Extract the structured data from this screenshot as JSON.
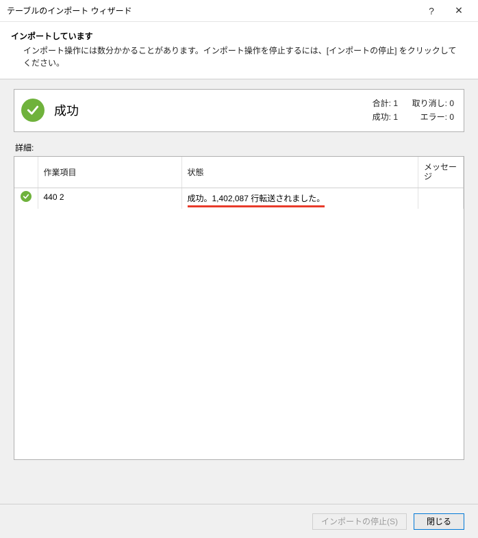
{
  "window": {
    "title": "テーブルのインポート ウィザード",
    "help_icon": "?",
    "close_icon": "✕"
  },
  "header": {
    "title": "インポートしています",
    "description": "インポート操作には数分かかることがあります。インポート操作を停止するには、[インポートの停止] をクリックしてください。"
  },
  "status": {
    "label": "成功",
    "counts": {
      "total_label": "合計:",
      "total_value": "1",
      "cancelled_label": "取り消し:",
      "cancelled_value": "0",
      "success_label": "成功:",
      "success_value": "1",
      "error_label": "エラー:",
      "error_value": "0"
    }
  },
  "details": {
    "label": "詳細:",
    "columns": {
      "icon": "",
      "task": "作業項目",
      "state": "状態",
      "message": "メッセージ"
    },
    "rows": [
      {
        "task": "440 2",
        "state": "成功。1,402,087 行転送されました。",
        "message": ""
      }
    ]
  },
  "footer": {
    "stop_label": "インポートの停止(S)",
    "close_label": "閉じる"
  }
}
